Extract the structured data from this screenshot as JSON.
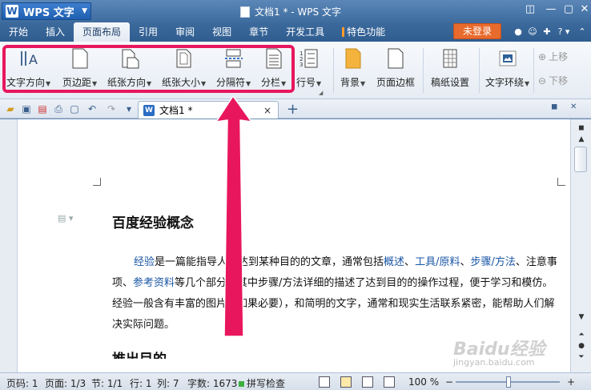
{
  "titlebar": {
    "app_name": "WPS 文字",
    "app_logo_letter": "W",
    "doc_title": "文档1 * - WPS 文字"
  },
  "menu": {
    "tabs": [
      "开始",
      "插入",
      "页面布局",
      "引用",
      "审阅",
      "视图",
      "章节",
      "开发工具",
      "特色功能"
    ],
    "active_tab": "页面布局",
    "login_label": "未登录",
    "help_label": "?"
  },
  "ribbon": {
    "buttons": [
      {
        "label": "文字方向",
        "dropdown": true
      },
      {
        "label": "页边距",
        "dropdown": true
      },
      {
        "label": "纸张方向",
        "dropdown": true
      },
      {
        "label": "纸张大小",
        "dropdown": true
      },
      {
        "label": "分隔符",
        "dropdown": true
      },
      {
        "label": "分栏",
        "dropdown": true
      },
      {
        "label": "行号",
        "dropdown": true
      },
      {
        "label": "背景",
        "dropdown": true
      },
      {
        "label": "页面边框",
        "dropdown": false
      },
      {
        "label": "稿纸设置",
        "dropdown": false
      },
      {
        "label": "文字环绕",
        "dropdown": true
      }
    ],
    "move_up": "上移",
    "move_down": "下移"
  },
  "doc_tab": {
    "icon_letter": "W",
    "title": "文档1 *",
    "close_label": "×",
    "new_tab_label": "+"
  },
  "document": {
    "heading": "百度经验概念",
    "para_links": {
      "jingyan": "经验",
      "gaishu": "概述",
      "gongju": "工具/原料",
      "buzhou": "步骤/方法",
      "cankao": "参考资料"
    },
    "para_texts": {
      "t1": "是一篇能指导人们达到某种目的的文章，通常包括",
      "sep": "、",
      "t2": "注意事项、",
      "t3": "等几个部分，其中步骤/方法详细的描述了达到目的的操作过程，便于学习和模仿。经验一般含有丰富的图片（如果必要），和简明的文字，通常和现实生活联系紧密，能帮助人们解决实际问题。"
    },
    "heading2": "推出目的"
  },
  "status": {
    "page_code": "页码: 1",
    "page": "页面: 1/3",
    "section": "节: 1/1",
    "line": "行: 1",
    "column": "列: 7",
    "word_count": "字数: 1673",
    "spell_check": "拼写检查",
    "zoom": "100 %",
    "zoom_minus": "−",
    "zoom_plus": "+",
    "zoom_level_percent": 100
  },
  "watermark": {
    "brand": "Baidu经验",
    "url": "jingyan.baidu.com"
  },
  "colors": {
    "highlight": "#e8175d",
    "link": "#1a56a6",
    "login": "#e86a2c"
  }
}
